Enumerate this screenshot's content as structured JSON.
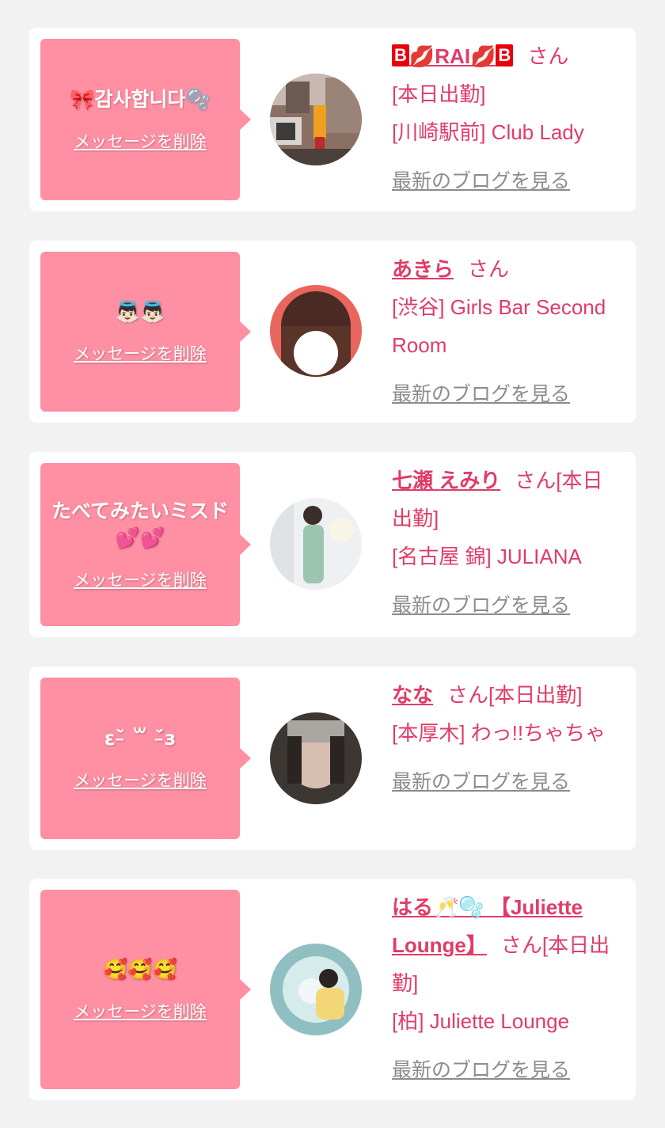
{
  "items": [
    {
      "message": "🎀감사합니다🫧",
      "delete_label": "メッセージを削除",
      "name_parts": [
        "B",
        "💋RAI💋",
        "B"
      ],
      "honorific": "さん",
      "lines": [
        "[本日出勤]",
        "[川崎駅前] Club Lady"
      ],
      "blog_label": "最新のブログを見る"
    },
    {
      "message": "👼🏻👼🏻",
      "delete_label": "メッセージを削除",
      "name": "あきら",
      "honorific": "さん",
      "lines": [
        "[渋谷] Girls Bar Second Room"
      ],
      "blog_label": "最新のブログを見る"
    },
    {
      "message": "たべてみたいミスド💕💕",
      "delete_label": "メッセージを削除",
      "name": "七瀬 えみり",
      "honorific": "さん[本日出勤]",
      "lines": [
        "[名古屋 錦] JULIANA"
      ],
      "blog_label": "最新のブログを見る"
    },
    {
      "message": "ε˘̵̀ ꒳ ˘̵́з",
      "delete_label": "メッセージを削除",
      "name": "なな",
      "honorific": "さん[本日出勤]",
      "lines": [
        "[本厚木] わっ!!ちゃちゃ"
      ],
      "blog_label": "最新のブログを見る"
    },
    {
      "message": "🥰🥰🥰",
      "delete_label": "メッセージを削除",
      "name": "はる🥂🫧 【Juliette Lounge】",
      "honorific": "さん[本日出勤]",
      "lines": [
        "[柏] Juliette Lounge"
      ],
      "blog_label": "最新のブログを見る"
    }
  ]
}
